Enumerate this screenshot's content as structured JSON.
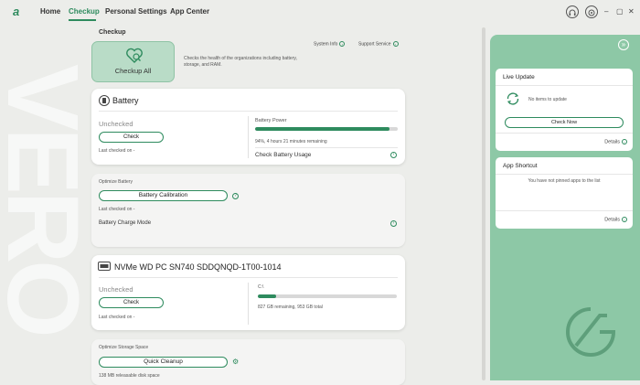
{
  "nav": {
    "items": [
      "Home",
      "Checkup",
      "Personal Settings",
      "App Center"
    ],
    "active": "Checkup"
  },
  "background_text": "VERO",
  "checkup": {
    "section_title": "Checkup",
    "button_label": "Checkup All",
    "description": "Checks the health of the organizations including battery, storage, and RAM.",
    "system_info": "System Info",
    "support_service": "Support Service"
  },
  "battery": {
    "title": "Battery",
    "status": "Unchecked",
    "check_label": "Check",
    "last_checked": "Last checked on -",
    "power_label": "Battery Power",
    "power_percent": 94,
    "power_text": "94%, 4 hours 21 minutes remaining",
    "usage_label": "Check Battery Usage"
  },
  "optimize_battery": {
    "title": "Optimize Battery",
    "calibration_label": "Battery Calibration",
    "last_checked": "Last checked on -",
    "charge_mode_label": "Battery Charge Mode"
  },
  "storage": {
    "title": "NVMe WD PC SN740 SDDQNQD-1T00-1014",
    "status": "Unchecked",
    "check_label": "Check",
    "last_checked": "Last checked on -",
    "drive": "C:\\",
    "used_fraction": 0.13,
    "drive_text": "827 GB remaining, 953 GB total"
  },
  "optimize_storage": {
    "title": "Optimize Storage Space",
    "cleanup_label": "Quick Cleanup",
    "reclaimable": "138 MB releasable disk space"
  },
  "live_update": {
    "title": "Live Update",
    "message": "No items to update",
    "check_now": "Check Now",
    "details": "Details"
  },
  "app_shortcut": {
    "title": "App Shortcut",
    "message": "You have not pinned apps to the list",
    "details": "Details"
  },
  "colors": {
    "accent": "#2e8b5e",
    "panel": "#8dc8a6",
    "checkup_button": "#b9dcc7"
  }
}
